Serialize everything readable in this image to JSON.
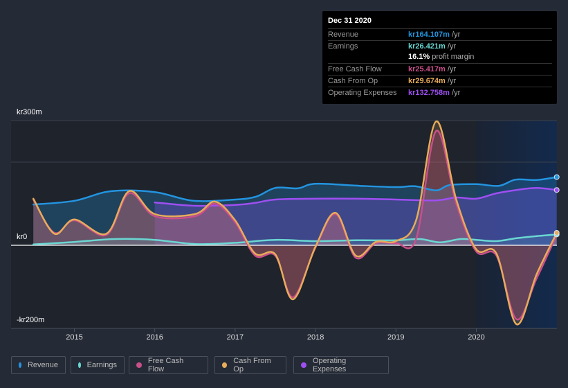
{
  "tooltip": {
    "date": "Dec 31 2020",
    "rows": [
      {
        "label": "Revenue",
        "value": "kr164.107m",
        "unit": " /yr",
        "color": "#2394df"
      },
      {
        "label": "Earnings",
        "value": "kr26.421m",
        "unit": " /yr",
        "color": "#6ad7d2"
      },
      {
        "label": "",
        "value": "16.1%",
        "unit": " profit margin",
        "color": "#ffffff"
      },
      {
        "label": "Free Cash Flow",
        "value": "kr25.417m",
        "unit": " /yr",
        "color": "#c94f8b"
      },
      {
        "label": "Cash From Op",
        "value": "kr29.674m",
        "unit": " /yr",
        "color": "#e8ac5a"
      },
      {
        "label": "Operating Expenses",
        "value": "kr132.758m",
        "unit": " /yr",
        "color": "#9e4ff2"
      }
    ]
  },
  "legend": [
    {
      "label": "Revenue",
      "color": "#2394df"
    },
    {
      "label": "Earnings",
      "color": "#6ad7d2"
    },
    {
      "label": "Free Cash Flow",
      "color": "#c94f8b"
    },
    {
      "label": "Cash From Op",
      "color": "#e8ac5a"
    },
    {
      "label": "Operating Expenses",
      "color": "#9e4ff2"
    }
  ],
  "chart_data": {
    "type": "area",
    "title": "",
    "xlabel": "",
    "ylabel": "",
    "unit": "kr (millions)",
    "y_tick_labels": [
      "kr300m",
      "kr0",
      "-kr200m"
    ],
    "ylim": [
      -200,
      300
    ],
    "xlim": [
      2014.5,
      2021.0
    ],
    "x_tick_labels": [
      "2015",
      "2016",
      "2017",
      "2018",
      "2019",
      "2020"
    ],
    "x_ticks": [
      2015,
      2016,
      2017,
      2018,
      2019,
      2020
    ],
    "grid": true,
    "legend_position": "bottom",
    "highlight_region": [
      2020.0,
      2021.0
    ],
    "series": [
      {
        "name": "Revenue",
        "color": "#2394df",
        "x": [
          2014.49,
          2015.0,
          2015.45,
          2016.0,
          2016.48,
          2017.0,
          2017.26,
          2017.5,
          2017.78,
          2018.0,
          2018.55,
          2019.0,
          2019.24,
          2019.5,
          2019.67,
          2020.0,
          2020.28,
          2020.49,
          2020.75,
          2021.0
        ],
        "values": [
          98,
          107,
          130,
          128,
          107,
          110,
          117,
          138,
          137,
          148,
          143,
          140,
          142,
          132,
          145,
          147,
          143,
          158,
          157,
          164
        ]
      },
      {
        "name": "Earnings",
        "color": "#6ad7d2",
        "x": [
          2014.49,
          2015.0,
          2015.5,
          2016.0,
          2016.5,
          2017.0,
          2017.5,
          2018.0,
          2018.5,
          2019.0,
          2019.3,
          2019.55,
          2019.8,
          2020.0,
          2020.25,
          2020.5,
          2020.75,
          2021.0
        ],
        "values": [
          2,
          8,
          15,
          13,
          3,
          6,
          13,
          10,
          12,
          12,
          15,
          7,
          15,
          13,
          10,
          17,
          22,
          26
        ]
      },
      {
        "name": "Free Cash Flow",
        "color": "#c94f8b",
        "x": [
          2014.49,
          2014.75,
          2015.0,
          2015.4,
          2015.68,
          2016.0,
          2016.5,
          2016.75,
          2017.0,
          2017.25,
          2017.5,
          2017.72,
          2018.0,
          2018.25,
          2018.5,
          2018.75,
          2019.0,
          2019.25,
          2019.5,
          2019.75,
          2020.0,
          2020.25,
          2020.5,
          2020.75,
          2021.0
        ],
        "values": [
          110,
          30,
          60,
          25,
          125,
          70,
          70,
          100,
          55,
          -25,
          -25,
          -125,
          -5,
          75,
          -30,
          5,
          5,
          15,
          275,
          100,
          -15,
          -25,
          -178,
          -80,
          25
        ]
      },
      {
        "name": "Cash From Op",
        "color": "#e8ac5a",
        "x": [
          2014.49,
          2014.75,
          2015.0,
          2015.4,
          2015.68,
          2016.0,
          2016.5,
          2016.75,
          2017.0,
          2017.25,
          2017.5,
          2017.72,
          2018.0,
          2018.25,
          2018.5,
          2018.75,
          2019.0,
          2019.25,
          2019.5,
          2019.75,
          2020.0,
          2020.25,
          2020.5,
          2020.75,
          2021.0
        ],
        "values": [
          112,
          28,
          62,
          28,
          130,
          75,
          75,
          105,
          60,
          -20,
          -22,
          -130,
          -3,
          78,
          -25,
          8,
          10,
          60,
          298,
          110,
          -10,
          -20,
          -190,
          -70,
          30
        ]
      },
      {
        "name": "Operating Expenses",
        "color": "#9e4ff2",
        "x": [
          2016.0,
          2016.5,
          2017.0,
          2017.25,
          2017.5,
          2018.0,
          2018.5,
          2019.0,
          2019.5,
          2019.75,
          2020.0,
          2020.25,
          2020.5,
          2020.75,
          2021.0
        ],
        "values": [
          103,
          95,
          97,
          102,
          110,
          112,
          112,
          110,
          108,
          115,
          112,
          125,
          133,
          138,
          133
        ]
      }
    ]
  }
}
